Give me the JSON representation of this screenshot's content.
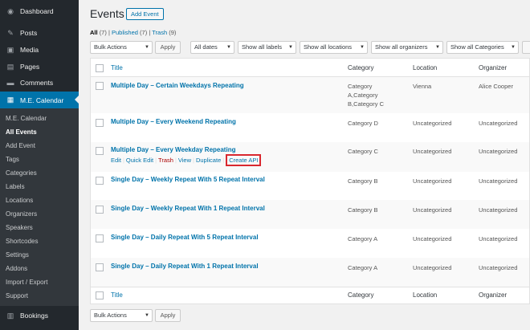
{
  "sidebar": {
    "items": [
      {
        "label": "Dashboard",
        "icon": "dashboard-icon",
        "glyph": "◉"
      },
      {
        "label": "Posts",
        "icon": "pin-icon",
        "glyph": "✎"
      },
      {
        "label": "Media",
        "icon": "media-icon",
        "glyph": "▣"
      },
      {
        "label": "Pages",
        "icon": "pages-icon",
        "glyph": "▤"
      },
      {
        "label": "Comments",
        "icon": "comment-icon",
        "glyph": "▬"
      },
      {
        "label": "M.E. Calendar",
        "icon": "calendar-icon",
        "glyph": "▦"
      }
    ],
    "submenu": [
      "M.E. Calendar",
      "All Events",
      "Add Event",
      "Tags",
      "Categories",
      "Labels",
      "Locations",
      "Organizers",
      "Speakers",
      "Shortcodes",
      "Settings",
      "Addons",
      "Import / Export",
      "Support"
    ],
    "bookings": {
      "label": "Bookings",
      "icon": "bookings-icon",
      "glyph": "▥"
    }
  },
  "header": {
    "title": "Events",
    "add_button": "Add Event"
  },
  "views": {
    "all": "All",
    "all_count": "(7)",
    "published": "Published",
    "published_count": "(7)",
    "trash": "Trash",
    "trash_count": "(9)"
  },
  "filters": {
    "bulk_actions": "Bulk Actions",
    "apply": "Apply",
    "dates": "All dates",
    "labels": "Show all labels",
    "locations": "Show all locations",
    "organizers": "Show all organizers",
    "categories": "Show all Categories"
  },
  "table": {
    "columns": {
      "title": "Title",
      "category": "Category",
      "location": "Location",
      "organizer": "Organizer"
    },
    "rows": [
      {
        "title": "Multiple Day – Certain Weekdays Repeating",
        "category": [
          "Category",
          "A,Category",
          "B,Category C"
        ],
        "location": "Vienna",
        "organizer": "Alice Cooper"
      },
      {
        "title": "Multiple Day – Every Weekend Repeating",
        "category": [
          "Category D"
        ],
        "location": "Uncategorized",
        "organizer": "Uncategorized"
      },
      {
        "title": "Multiple Day – Every Weekday Repeating",
        "category": [
          "Category C"
        ],
        "location": "Uncategorized",
        "organizer": "Uncategorized"
      },
      {
        "title": "Single Day – Weekly Repeat With 5 Repeat Interval",
        "category": [
          "Category B"
        ],
        "location": "Uncategorized",
        "organizer": "Uncategorized"
      },
      {
        "title": "Single Day – Weekly Repeat With 1 Repeat Interval",
        "category": [
          "Category B"
        ],
        "location": "Uncategorized",
        "organizer": "Uncategorized"
      },
      {
        "title": "Single Day – Daily Repeat With 5 Repeat Interval",
        "category": [
          "Category A"
        ],
        "location": "Uncategorized",
        "organizer": "Uncategorized"
      },
      {
        "title": "Single Day – Daily Repeat With 1 Repeat Interval",
        "category": [
          "Category A"
        ],
        "location": "Uncategorized",
        "organizer": "Uncategorized"
      }
    ],
    "row_actions": {
      "edit": "Edit",
      "quick_edit": "Quick Edit",
      "trash": "Trash",
      "view": "View",
      "duplicate": "Duplicate",
      "create_api": "Create API"
    }
  },
  "colors": {
    "accent": "#0073aa",
    "sidebar": "#23282d",
    "highlight": "#d9282f",
    "trash": "#a00"
  }
}
